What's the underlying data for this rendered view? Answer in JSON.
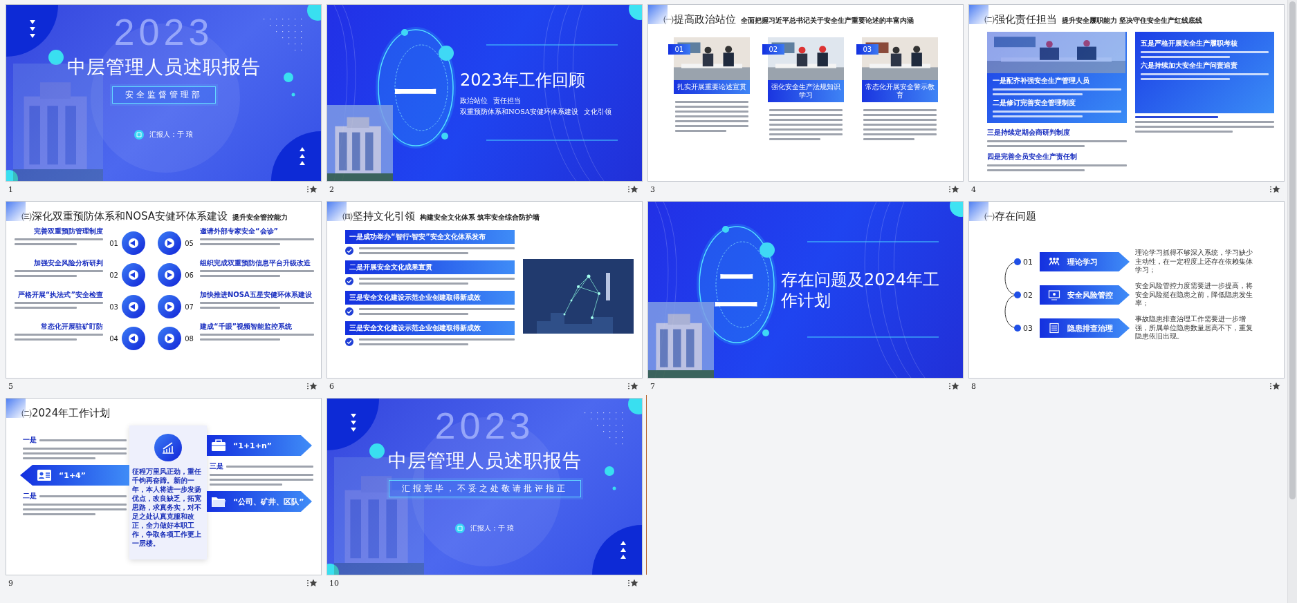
{
  "slides": [
    {
      "number": "1",
      "kind": "cover",
      "insertion_point": false,
      "year": "2023",
      "title": "中层管理人员述职报告",
      "subtitle": "安全监督管理部",
      "reporter": "汇报人：于 琅"
    },
    {
      "number": "2",
      "kind": "section",
      "insertion_point": false,
      "numeral": "一",
      "title": "2023年工作回顾",
      "topics": [
        "政治站位",
        "责任担当",
        "双重预防体系和NOSA安健环体系建设",
        "文化引领"
      ]
    },
    {
      "number": "3",
      "kind": "cards",
      "insertion_point": false,
      "title": "㈠提高政治站位",
      "subtitle": "全面把握习近平总书记关于安全生产重要论述的丰富内涵",
      "cards": [
        {
          "index": "01",
          "caption": "扎实开展重要论述宣贯"
        },
        {
          "index": "02",
          "caption": "强化安全生产法规知识学习"
        },
        {
          "index": "03",
          "caption": "常态化开展安全警示教育"
        }
      ]
    },
    {
      "number": "4",
      "kind": "columns",
      "insertion_point": false,
      "title": "㈡强化责任担当",
      "subtitle": "提升安全履职能力 坚决守住安全生产红线底线",
      "columns": [
        {
          "panel_headings": [
            "一是配齐补强安全生产管理人员",
            "二是修订完善安全管理制度"
          ],
          "headings": [
            "三是持续定期会商研判制度",
            "四是完善全员安全生产责任制"
          ]
        },
        {
          "panel_headings": [
            "五是严格开展安全生产履职考核",
            "六是持续加大安全生产问责追责"
          ]
        }
      ]
    },
    {
      "number": "5",
      "kind": "numbered",
      "insertion_point": false,
      "title": "㈢深化双重预防体系和NOSA安健环体系建设",
      "subtitle": "提升安全管控能力",
      "items": [
        {
          "index": "01",
          "heading": "完善双重预防管理制度"
        },
        {
          "index": "02",
          "heading": "加强安全风险分析研判"
        },
        {
          "index": "03",
          "heading": "严格开展“执法式”安全检查"
        },
        {
          "index": "04",
          "heading": "常态化开展驻矿盯防"
        },
        {
          "index": "05",
          "heading": "邀请外部专家安全“会诊”"
        },
        {
          "index": "06",
          "heading": "组织完成双重预防信息平台升级改造"
        },
        {
          "index": "07",
          "heading": "加快推进NOSA五星安健环体系建设"
        },
        {
          "index": "08",
          "heading": "建成“千眼”视频智能监控系统"
        }
      ]
    },
    {
      "number": "6",
      "kind": "checklist",
      "insertion_point": false,
      "title": "㈣坚持文化引领",
      "subtitle": "构建安全文化体系 筑牢安全综合防护墙",
      "items": [
        "一是成功举办“智行·智安”安全文化体系发布",
        "二是开展安全文化成果宣贯",
        "三是安全文化建设示范企业创建取得新成效",
        "三是安全文化建设示范企业创建取得新成效"
      ]
    },
    {
      "number": "7",
      "kind": "section",
      "insertion_point": false,
      "numeral": "二",
      "title": "存在问题及2024年工作计划"
    },
    {
      "number": "8",
      "kind": "problems",
      "insertion_point": false,
      "title": "㈠存在问题",
      "items": [
        {
          "index": "01",
          "label": "理论学习",
          "text": "理论学习抓得不够深入系统，学习缺少主动性，在一定程度上还存在依赖集体学习；"
        },
        {
          "index": "02",
          "label": "安全风险管控",
          "text": "安全风险管控力度需要进一步提高，将安全风险挺在隐患之前，降低隐患发生率；"
        },
        {
          "index": "03",
          "label": "隐患排查治理",
          "text": "事故隐患排查治理工作需要进一步增强，所属单位隐患数量居高不下，重复隐患依旧出现。"
        }
      ]
    },
    {
      "number": "9",
      "kind": "plan",
      "insertion_point": false,
      "title": "㈡2024年工作计划",
      "points": [
        "一是",
        "二是",
        "三是"
      ],
      "banners": [
        "“1+4”",
        "“1+1+n”",
        "“公司、矿井、区队”"
      ],
      "quote": "征程万里风正劲，重任千钧再奋蹄。新的一年，本人将进一步发扬优点，改良缺乏，拓宽思路，求真务实，对不足之处认真克服和改正，全力做好本职工作，争取各项工作更上一层楼。"
    },
    {
      "number": "10",
      "kind": "cover",
      "insertion_point": true,
      "year": "2023",
      "title": "中层管理人员述职报告",
      "subtitle": "汇报完毕，不妥之处敬请批评指正",
      "reporter": "汇报人：于 琅"
    }
  ]
}
